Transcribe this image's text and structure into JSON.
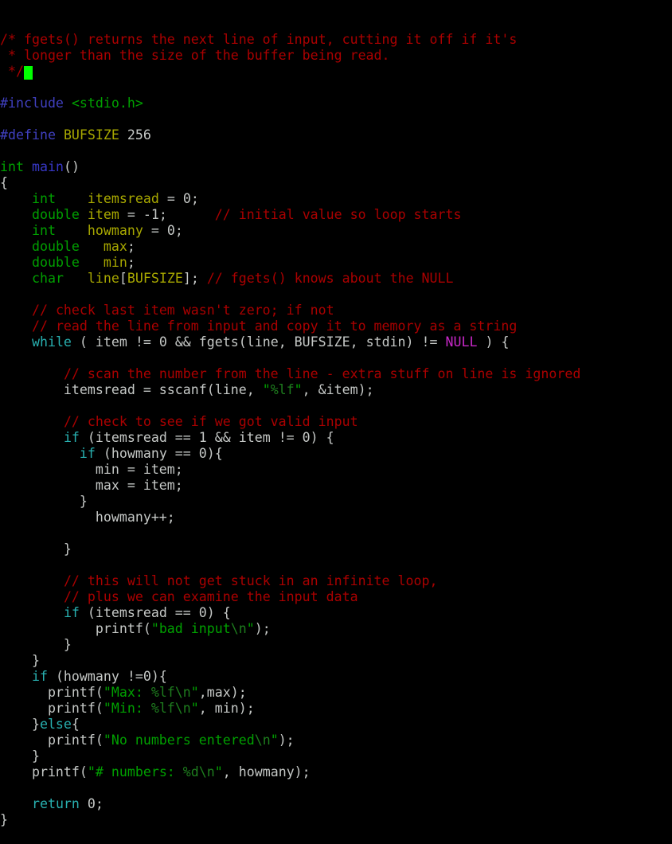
{
  "app": {
    "kind": "terminal-code-editor",
    "language": "C",
    "background_color": "#000000",
    "default_text_color": "#c5c8c6"
  },
  "palette": {
    "comment": "#aa0000",
    "preprocessor": "#4040c0",
    "type_keyword": "#00a000",
    "function_name": "#3838c8",
    "identifier": "#a8a800",
    "keyword": "#28b0b0",
    "constant": "#c828c8",
    "string": "#00a000",
    "format_specifier": "#1e7d1e",
    "plain": "#c5c8c6",
    "cursor": "#00ff00"
  },
  "cursor": {
    "visible": true,
    "line": 3,
    "column": 3,
    "color": "#00ff00"
  },
  "code": {
    "lines": [
      {
        "n": 1,
        "tokens": [
          {
            "t": "comment",
            "s": "/* fgets() returns the next line of input, cutting it off if it's"
          }
        ]
      },
      {
        "n": 2,
        "tokens": [
          {
            "t": "comment",
            "s": " * longer than the size of the buffer being read."
          }
        ]
      },
      {
        "n": 3,
        "tokens": [
          {
            "t": "comment",
            "s": " */"
          },
          {
            "t": "cursor",
            "s": " "
          }
        ]
      },
      {
        "n": 4,
        "tokens": []
      },
      {
        "n": 5,
        "tokens": [
          {
            "t": "preproc",
            "s": "#include"
          },
          {
            "t": "plain",
            "s": " "
          },
          {
            "t": "string",
            "s": "<stdio.h>"
          }
        ]
      },
      {
        "n": 6,
        "tokens": []
      },
      {
        "n": 7,
        "tokens": [
          {
            "t": "preproc",
            "s": "#define"
          },
          {
            "t": "plain",
            "s": " "
          },
          {
            "t": "macro",
            "s": "BUFSIZE"
          },
          {
            "t": "plain",
            "s": " "
          },
          {
            "t": "number",
            "s": "256"
          }
        ]
      },
      {
        "n": 8,
        "tokens": []
      },
      {
        "n": 9,
        "tokens": [
          {
            "t": "type",
            "s": "int"
          },
          {
            "t": "plain",
            "s": " "
          },
          {
            "t": "func",
            "s": "main"
          },
          {
            "t": "plain",
            "s": "()"
          }
        ]
      },
      {
        "n": 10,
        "tokens": [
          {
            "t": "plain",
            "s": "{"
          }
        ]
      },
      {
        "n": 11,
        "tokens": [
          {
            "t": "plain",
            "s": "    "
          },
          {
            "t": "type",
            "s": "int"
          },
          {
            "t": "plain",
            "s": "    "
          },
          {
            "t": "ident",
            "s": "itemsread"
          },
          {
            "t": "plain",
            "s": " = "
          },
          {
            "t": "number",
            "s": "0"
          },
          {
            "t": "plain",
            "s": ";"
          }
        ]
      },
      {
        "n": 12,
        "tokens": [
          {
            "t": "plain",
            "s": "    "
          },
          {
            "t": "type",
            "s": "double"
          },
          {
            "t": "plain",
            "s": " "
          },
          {
            "t": "ident",
            "s": "item"
          },
          {
            "t": "plain",
            "s": " = -"
          },
          {
            "t": "number",
            "s": "1"
          },
          {
            "t": "plain",
            "s": ";      "
          },
          {
            "t": "comment",
            "s": "// initial value so loop starts"
          }
        ]
      },
      {
        "n": 13,
        "tokens": [
          {
            "t": "plain",
            "s": "    "
          },
          {
            "t": "type",
            "s": "int"
          },
          {
            "t": "plain",
            "s": "    "
          },
          {
            "t": "ident",
            "s": "howmany"
          },
          {
            "t": "plain",
            "s": " = "
          },
          {
            "t": "number",
            "s": "0"
          },
          {
            "t": "plain",
            "s": ";"
          }
        ]
      },
      {
        "n": 14,
        "tokens": [
          {
            "t": "plain",
            "s": "    "
          },
          {
            "t": "type",
            "s": "double"
          },
          {
            "t": "plain",
            "s": "   "
          },
          {
            "t": "ident",
            "s": "max"
          },
          {
            "t": "plain",
            "s": ";"
          }
        ]
      },
      {
        "n": 15,
        "tokens": [
          {
            "t": "plain",
            "s": "    "
          },
          {
            "t": "type",
            "s": "double"
          },
          {
            "t": "plain",
            "s": "   "
          },
          {
            "t": "ident",
            "s": "min"
          },
          {
            "t": "plain",
            "s": ";"
          }
        ]
      },
      {
        "n": 16,
        "tokens": [
          {
            "t": "plain",
            "s": "    "
          },
          {
            "t": "type",
            "s": "char"
          },
          {
            "t": "plain",
            "s": "   "
          },
          {
            "t": "ident",
            "s": "line"
          },
          {
            "t": "plain",
            "s": "["
          },
          {
            "t": "macro",
            "s": "BUFSIZE"
          },
          {
            "t": "plain",
            "s": "]; "
          },
          {
            "t": "comment",
            "s": "// fgets() knows about the NULL"
          }
        ]
      },
      {
        "n": 17,
        "tokens": []
      },
      {
        "n": 18,
        "tokens": [
          {
            "t": "plain",
            "s": "    "
          },
          {
            "t": "comment",
            "s": "// check last item wasn't zero; if not"
          }
        ]
      },
      {
        "n": 19,
        "tokens": [
          {
            "t": "plain",
            "s": "    "
          },
          {
            "t": "comment",
            "s": "// read the line from input and copy it to memory as a string"
          }
        ]
      },
      {
        "n": 20,
        "tokens": [
          {
            "t": "plain",
            "s": "    "
          },
          {
            "t": "keyword",
            "s": "while"
          },
          {
            "t": "plain",
            "s": " ( item != "
          },
          {
            "t": "number",
            "s": "0"
          },
          {
            "t": "plain",
            "s": " && fgets(line, BUFSIZE, stdin) != "
          },
          {
            "t": "constant",
            "s": "NULL"
          },
          {
            "t": "plain",
            "s": " ) {"
          }
        ]
      },
      {
        "n": 21,
        "tokens": []
      },
      {
        "n": 22,
        "tokens": [
          {
            "t": "plain",
            "s": "        "
          },
          {
            "t": "comment",
            "s": "// scan the number from the line - extra stuff on line is ignored"
          }
        ]
      },
      {
        "n": 23,
        "tokens": [
          {
            "t": "plain",
            "s": "        itemsread = sscanf(line, "
          },
          {
            "t": "string",
            "s": "\""
          },
          {
            "t": "format",
            "s": "%lf"
          },
          {
            "t": "string",
            "s": "\""
          },
          {
            "t": "plain",
            "s": ", &item);"
          }
        ]
      },
      {
        "n": 24,
        "tokens": []
      },
      {
        "n": 25,
        "tokens": [
          {
            "t": "plain",
            "s": "        "
          },
          {
            "t": "comment",
            "s": "// check to see if we got valid input"
          }
        ]
      },
      {
        "n": 26,
        "tokens": [
          {
            "t": "plain",
            "s": "        "
          },
          {
            "t": "keyword",
            "s": "if"
          },
          {
            "t": "plain",
            "s": " (itemsread == "
          },
          {
            "t": "number",
            "s": "1"
          },
          {
            "t": "plain",
            "s": " && item != "
          },
          {
            "t": "number",
            "s": "0"
          },
          {
            "t": "plain",
            "s": ") {"
          }
        ]
      },
      {
        "n": 27,
        "tokens": [
          {
            "t": "plain",
            "s": "          "
          },
          {
            "t": "keyword",
            "s": "if"
          },
          {
            "t": "plain",
            "s": " (howmany == "
          },
          {
            "t": "number",
            "s": "0"
          },
          {
            "t": "plain",
            "s": "){"
          }
        ]
      },
      {
        "n": 28,
        "tokens": [
          {
            "t": "plain",
            "s": "            min = item;"
          }
        ]
      },
      {
        "n": 29,
        "tokens": [
          {
            "t": "plain",
            "s": "            max = item;"
          }
        ]
      },
      {
        "n": 30,
        "tokens": [
          {
            "t": "plain",
            "s": "          }"
          }
        ]
      },
      {
        "n": 31,
        "tokens": [
          {
            "t": "plain",
            "s": "            howmany++;"
          }
        ]
      },
      {
        "n": 32,
        "tokens": []
      },
      {
        "n": 33,
        "tokens": [
          {
            "t": "plain",
            "s": "        }"
          }
        ]
      },
      {
        "n": 34,
        "tokens": []
      },
      {
        "n": 35,
        "tokens": [
          {
            "t": "plain",
            "s": "        "
          },
          {
            "t": "comment",
            "s": "// this will not get stuck in an infinite loop,"
          }
        ]
      },
      {
        "n": 36,
        "tokens": [
          {
            "t": "plain",
            "s": "        "
          },
          {
            "t": "comment",
            "s": "// plus we can examine the input data"
          }
        ]
      },
      {
        "n": 37,
        "tokens": [
          {
            "t": "plain",
            "s": "        "
          },
          {
            "t": "keyword",
            "s": "if"
          },
          {
            "t": "plain",
            "s": " (itemsread == "
          },
          {
            "t": "number",
            "s": "0"
          },
          {
            "t": "plain",
            "s": ") {"
          }
        ]
      },
      {
        "n": 38,
        "tokens": [
          {
            "t": "plain",
            "s": "            printf("
          },
          {
            "t": "string",
            "s": "\"bad input"
          },
          {
            "t": "format",
            "s": "\\n"
          },
          {
            "t": "string",
            "s": "\""
          },
          {
            "t": "plain",
            "s": ");"
          }
        ]
      },
      {
        "n": 39,
        "tokens": [
          {
            "t": "plain",
            "s": "        }"
          }
        ]
      },
      {
        "n": 40,
        "tokens": [
          {
            "t": "plain",
            "s": "    }"
          }
        ]
      },
      {
        "n": 41,
        "tokens": [
          {
            "t": "plain",
            "s": "    "
          },
          {
            "t": "keyword",
            "s": "if"
          },
          {
            "t": "plain",
            "s": " (howmany !="
          },
          {
            "t": "number",
            "s": "0"
          },
          {
            "t": "plain",
            "s": "){"
          }
        ]
      },
      {
        "n": 42,
        "tokens": [
          {
            "t": "plain",
            "s": "      printf("
          },
          {
            "t": "string",
            "s": "\"Max: "
          },
          {
            "t": "format",
            "s": "%lf\\n"
          },
          {
            "t": "string",
            "s": "\""
          },
          {
            "t": "plain",
            "s": ",max);"
          }
        ]
      },
      {
        "n": 43,
        "tokens": [
          {
            "t": "plain",
            "s": "      printf("
          },
          {
            "t": "string",
            "s": "\"Min: "
          },
          {
            "t": "format",
            "s": "%lf\\n"
          },
          {
            "t": "string",
            "s": "\""
          },
          {
            "t": "plain",
            "s": ", min);"
          }
        ]
      },
      {
        "n": 44,
        "tokens": [
          {
            "t": "plain",
            "s": "    }"
          },
          {
            "t": "keyword",
            "s": "else"
          },
          {
            "t": "plain",
            "s": "{"
          }
        ]
      },
      {
        "n": 45,
        "tokens": [
          {
            "t": "plain",
            "s": "      printf("
          },
          {
            "t": "string",
            "s": "\"No numbers entered"
          },
          {
            "t": "format",
            "s": "\\n"
          },
          {
            "t": "string",
            "s": "\""
          },
          {
            "t": "plain",
            "s": ");"
          }
        ]
      },
      {
        "n": 46,
        "tokens": [
          {
            "t": "plain",
            "s": "    }"
          }
        ]
      },
      {
        "n": 47,
        "tokens": [
          {
            "t": "plain",
            "s": "    printf("
          },
          {
            "t": "string",
            "s": "\"# numbers: "
          },
          {
            "t": "format",
            "s": "%d\\n"
          },
          {
            "t": "string",
            "s": "\""
          },
          {
            "t": "plain",
            "s": ", howmany);"
          }
        ]
      },
      {
        "n": 48,
        "tokens": []
      },
      {
        "n": 49,
        "tokens": [
          {
            "t": "plain",
            "s": "    "
          },
          {
            "t": "keyword",
            "s": "return"
          },
          {
            "t": "plain",
            "s": " "
          },
          {
            "t": "number",
            "s": "0"
          },
          {
            "t": "plain",
            "s": ";"
          }
        ]
      },
      {
        "n": 50,
        "tokens": [
          {
            "t": "plain",
            "s": "}"
          }
        ]
      }
    ]
  }
}
